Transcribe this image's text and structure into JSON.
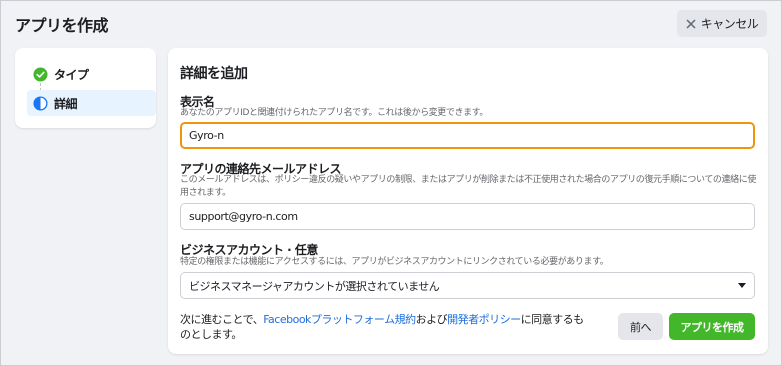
{
  "dialog": {
    "title": "アプリを作成",
    "cancel_label": "キャンセル"
  },
  "steps": [
    {
      "label": "タイプ",
      "state": "completed",
      "icon": "check-circle-icon"
    },
    {
      "label": "詳細",
      "state": "current",
      "icon": "half-circle-icon"
    }
  ],
  "form": {
    "heading": "詳細を追加",
    "display_name": {
      "label": "表示名",
      "help": "あなたのアプリIDと関連付けられたアプリ名です。これは後から変更できます。",
      "value": "Gyro-n"
    },
    "contact_email": {
      "label": "アプリの連絡先メールアドレス",
      "help": "このメールアドレスは、ポリシー違反の疑いやアプリの制限、またはアプリが削除または不正使用された場合のアプリの復元手順についての連絡に使用されます。",
      "value": "support@gyro-n.com"
    },
    "business_account": {
      "label": "ビジネスアカウント · 任意",
      "help": "特定の権限または機能にアクセスするには、アプリがビジネスアカウントにリンクされている必要があります。",
      "selected": "ビジネスマネージャアカウントが選択されていません"
    }
  },
  "footer": {
    "text_before": "次に進むことで、",
    "link_platform": "Facebookプラットフォーム規約",
    "text_middle": "および",
    "link_policy": "開発者ポリシー",
    "text_after": "に同意するものとします。",
    "back_label": "前へ",
    "create_label": "アプリを作成"
  },
  "colors": {
    "primary_green": "#42b72a",
    "link_blue": "#216fdb",
    "focus_orange": "#f0940a",
    "current_step_bg": "#e7f3ff"
  }
}
